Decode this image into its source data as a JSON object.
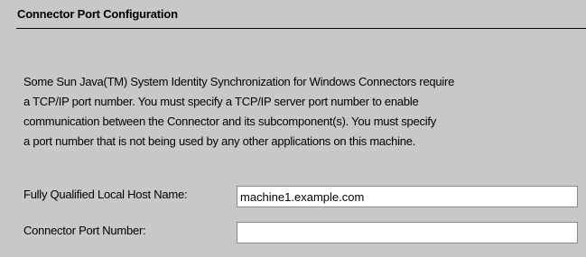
{
  "panel": {
    "title": "Connector Port Configuration",
    "description": [
      "Some Sun Java(TM) System Identity Synchronization for Windows Connectors require",
      "a TCP/IP port number. You must specify a TCP/IP server port number to enable",
      "communication between the Connector and its subcomponent(s).  You must specify",
      "a port number that is not being used by any other applications on this machine."
    ],
    "fields": {
      "host_name": {
        "label": "Fully Qualified Local Host Name:",
        "value": "machine1.example.com"
      },
      "port_number": {
        "label": "Connector Port Number:",
        "value": ""
      }
    }
  }
}
